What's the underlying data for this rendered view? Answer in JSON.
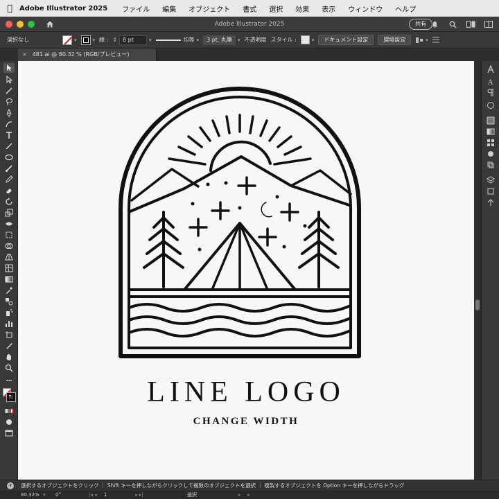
{
  "menubar": {
    "app_name": "Adobe Illustrator 2025",
    "items": [
      "ファイル",
      "編集",
      "オブジェクト",
      "書式",
      "選択",
      "効果",
      "表示",
      "ウィンドウ",
      "ヘルプ"
    ]
  },
  "titlebar": {
    "title": "Adobe Illustrator 2025",
    "share_label": "共有"
  },
  "controlbar": {
    "selection_status": "選択なし",
    "stroke_label": "線 :",
    "stroke_weight": "8 pt",
    "profile_label": "均等",
    "brush_label": "3 pt. 丸筆",
    "opacity_label": "不透明度",
    "style_label": "スタイル :",
    "document_setup_label": "ドキュメント設定",
    "preferences_label": "環境設定"
  },
  "document_tab": {
    "close_glyph": "×",
    "title": "481.ai @ 80.32 % (RGB/プレビュー)"
  },
  "artwork": {
    "title": "LINE LOGO",
    "subtitle": "CHANGE WIDTH"
  },
  "hintbar": {
    "icon_glyph": "?",
    "text": "選択するオブジェクトをクリック ｜ Shift キーを押しながらクリックして複数のオブジェクトを選択 ｜ 複製するオブジェクトを Option キーを押しながらドラッグ"
  },
  "statusbar": {
    "zoom": "80.32%",
    "rotation": "0°",
    "artboard_number": "1",
    "tool_name": "選択"
  },
  "colors": {
    "menubar_bg": "#e9e9ea",
    "panel_bg": "#383838",
    "canvas_bg": "#f7f7f7",
    "artwork": "#111111",
    "traffic_close": "#ff5f57",
    "traffic_min": "#febc2e",
    "traffic_max": "#28c840"
  },
  "tools": [
    "selection-tool",
    "direct-selection-tool",
    "magic-wand-tool",
    "lasso-tool",
    "pen-tool",
    "curvature-tool",
    "type-tool",
    "line-tool",
    "ellipse-tool",
    "paintbrush-tool",
    "pencil-tool",
    "shaper-tool",
    "eraser-tool",
    "rotate-tool",
    "scale-tool",
    "width-tool",
    "free-transform-tool",
    "shape-builder-tool",
    "perspective-grid-tool",
    "mesh-tool",
    "gradient-tool",
    "eyedropper-tool",
    "blend-tool",
    "symbol-sprayer-tool",
    "column-graph-tool",
    "artboard-tool",
    "slice-tool",
    "hand-tool",
    "zoom-tool"
  ]
}
